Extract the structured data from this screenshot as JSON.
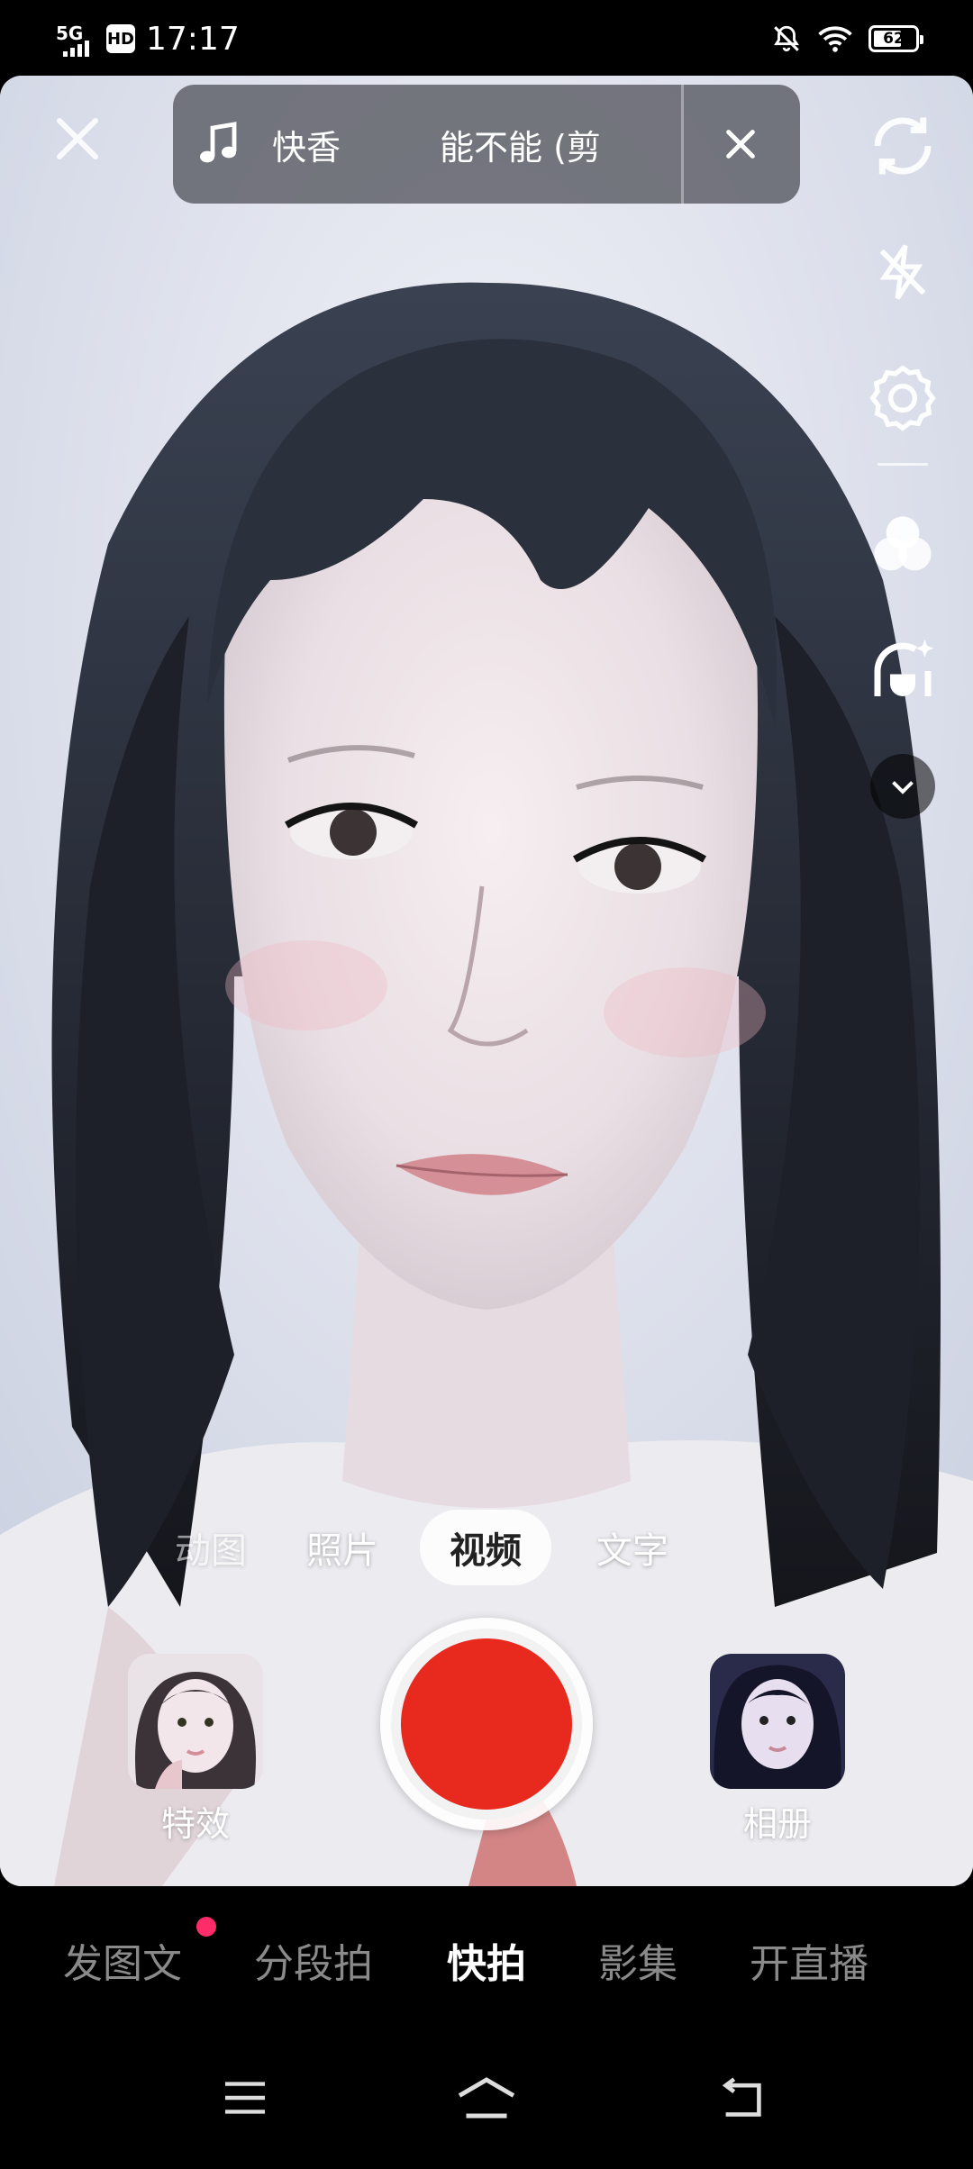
{
  "status_bar": {
    "network": "5G",
    "hd": "HD",
    "time": "17:17",
    "battery": "62",
    "icons": [
      "mute-bell-icon",
      "wifi-icon",
      "battery-icon"
    ]
  },
  "music": {
    "title_part1": "快香",
    "title_part2": "能不能 (剪",
    "icon": "music-note-icon"
  },
  "right_tools": [
    "flip-camera-icon",
    "flash-off-icon",
    "settings-icon",
    "filter-icon",
    "beauty-icon",
    "chevron-down-icon"
  ],
  "modes": [
    {
      "label": "动图",
      "state": "faded"
    },
    {
      "label": "照片",
      "state": "normal"
    },
    {
      "label": "视频",
      "state": "active"
    },
    {
      "label": "文字",
      "state": "normal"
    }
  ],
  "effects_label": "特效",
  "album_label": "相册",
  "bottom_tabs": [
    {
      "label": "发图文",
      "badge": true
    },
    {
      "label": "分段拍",
      "badge": false
    },
    {
      "label": "快拍",
      "badge": false,
      "active": true
    },
    {
      "label": "影集",
      "badge": false
    },
    {
      "label": "开直播",
      "badge": false
    }
  ],
  "colors": {
    "shutter_red": "#e8291e",
    "badge_pink": "#ff2c6a",
    "inactive_tab": "#8a8a8a"
  },
  "nav_icons": [
    "menu-icon",
    "home-icon",
    "back-icon"
  ]
}
